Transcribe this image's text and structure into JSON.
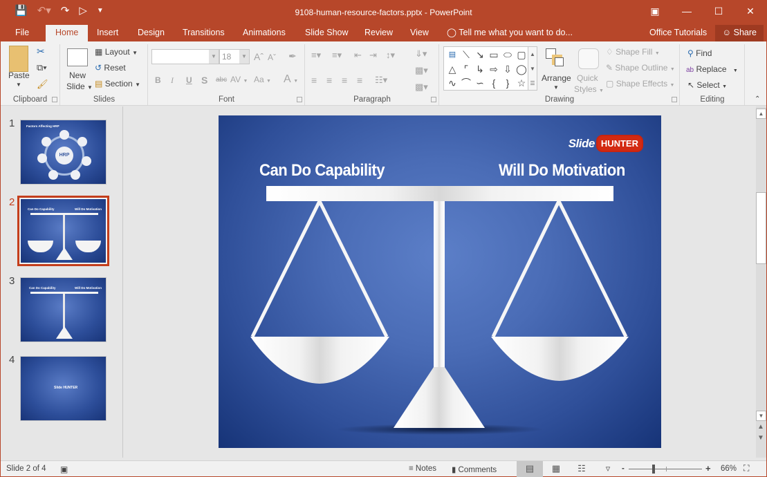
{
  "window": {
    "title": "9108-human-resource-factors.pptx - PowerPoint",
    "controls": [
      "ribbon-display-options",
      "minimize",
      "maximize",
      "close"
    ]
  },
  "qat": {
    "items": [
      "save",
      "undo",
      "redo",
      "start-from-beginning",
      "customize"
    ]
  },
  "tabs": {
    "items": [
      {
        "label": "File"
      },
      {
        "label": "Home",
        "active": true
      },
      {
        "label": "Insert"
      },
      {
        "label": "Design"
      },
      {
        "label": "Transitions"
      },
      {
        "label": "Animations"
      },
      {
        "label": "Slide Show"
      },
      {
        "label": "Review"
      },
      {
        "label": "View"
      }
    ],
    "tell_me": "Tell me what you want to do...",
    "office_tutorials": "Office Tutorials",
    "share": "Share"
  },
  "ribbon": {
    "clipboard": {
      "label": "Clipboard",
      "paste": "Paste"
    },
    "slides": {
      "label": "Slides",
      "new_slide_1": "New",
      "new_slide_2": "Slide",
      "layout": "Layout",
      "reset": "Reset",
      "section": "Section"
    },
    "font": {
      "label": "Font",
      "font_name": "",
      "font_size": "18",
      "bold": "B",
      "italic": "I",
      "underline": "U",
      "shadow": "S",
      "strike": "abc",
      "spacing": "AV",
      "case": "Aa",
      "color": "A"
    },
    "paragraph": {
      "label": "Paragraph"
    },
    "drawing": {
      "label": "Drawing",
      "arrange": "Arrange",
      "quick_styles_1": "Quick",
      "quick_styles_2": "Styles",
      "shape_fill": "Shape Fill",
      "shape_outline": "Shape Outline",
      "shape_effects": "Shape Effects"
    },
    "editing": {
      "label": "Editing",
      "find": "Find",
      "replace": "Replace",
      "select": "Select"
    }
  },
  "thumbnails": [
    {
      "number": "1",
      "title": "Factors Affecting HRP",
      "center": "HRP"
    },
    {
      "number": "2",
      "left": "Can Do Capability",
      "right": "Will Do Motivation",
      "active": true
    },
    {
      "number": "3",
      "left": "Can Do Capability",
      "right": "Will Do Motivation"
    },
    {
      "number": "4",
      "logo": "Slide HUNTER"
    }
  ],
  "slide": {
    "left_title": "Can Do Capability",
    "right_title": "Will Do Motivation",
    "logo_slide": "Slide",
    "logo_hunter": "HUNTER"
  },
  "status": {
    "slide_info": "Slide 2 of 4",
    "notes": "Notes",
    "comments": "Comments",
    "zoom_minus": "-",
    "zoom_plus": "+",
    "zoom_level": "66%"
  },
  "colors": {
    "accent": "#b7472a",
    "active_slide": "#c43e1c",
    "slide_bg": "#4a6cb6",
    "logo_red": "#d32a12"
  }
}
